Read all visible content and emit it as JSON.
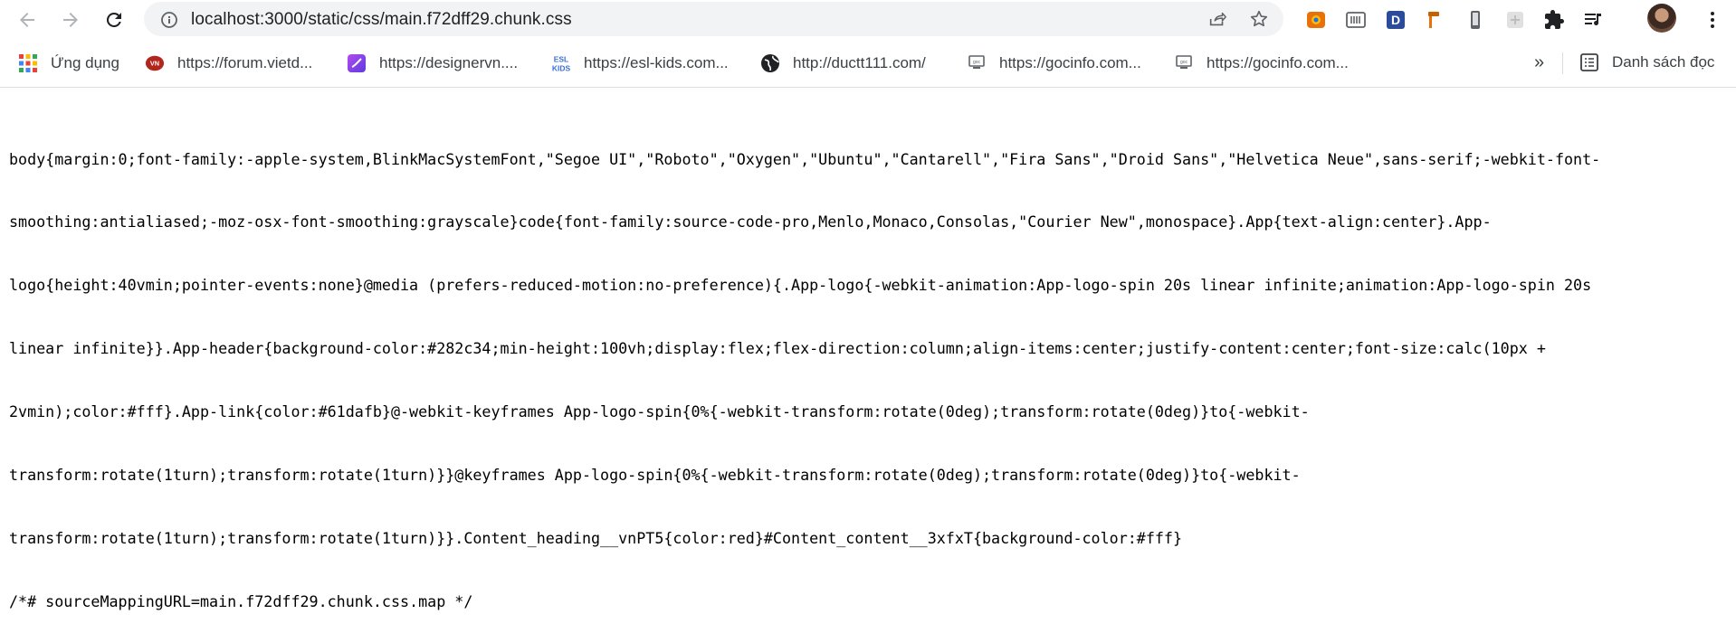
{
  "browser": {
    "url": "localhost:3000/static/css/main.f72dff29.chunk.css",
    "nav_icons": [
      "back-arrow-icon",
      "forward-arrow-icon",
      "reload-icon"
    ],
    "omnibox_icons": [
      "info-icon",
      "share-icon",
      "star-icon"
    ],
    "extensions": [
      "orange-camera-extension-icon",
      "barcode-extension-icon",
      "d-badge-extension-icon",
      "hammer-extension-icon",
      "phone-extension-icon",
      "gray-square-extension-icon",
      "puzzle-icon",
      "media-control-icon"
    ],
    "menu_icon": "three-dots-menu-icon"
  },
  "bookmarks": {
    "apps_label": "Ứng dụng",
    "items": [
      {
        "label": "https://forum.vietd...",
        "icon": "forum-favicon",
        "color": "#b3261e"
      },
      {
        "label": "https://designervn....",
        "icon": "designervn-favicon",
        "color": "#7b3fe4"
      },
      {
        "label": "https://esl-kids.com...",
        "icon": "esl-kids-favicon",
        "color": "#3b6fd6"
      },
      {
        "label": "http://ductt111.com/",
        "icon": "globe-icon",
        "color": "#202124"
      },
      {
        "label": "https://gocinfo.com...",
        "icon": "gocinfo-favicon",
        "color": "#5f6368"
      },
      {
        "label": "https://gocinfo.com...",
        "icon": "gocinfo-favicon",
        "color": "#5f6368"
      }
    ],
    "more_label": "»",
    "reading_list_label": "Danh sách đọc"
  },
  "content": {
    "lines": [
      "body{margin:0;font-family:-apple-system,BlinkMacSystemFont,\"Segoe UI\",\"Roboto\",\"Oxygen\",\"Ubuntu\",\"Cantarell\",\"Fira Sans\",\"Droid Sans\",\"Helvetica Neue\",sans-serif;-webkit-font-",
      "smoothing:antialiased;-moz-osx-font-smoothing:grayscale}code{font-family:source-code-pro,Menlo,Monaco,Consolas,\"Courier New\",monospace}.App{text-align:center}.App-",
      "logo{height:40vmin;pointer-events:none}@media (prefers-reduced-motion:no-preference){.App-logo{-webkit-animation:App-logo-spin 20s linear infinite;animation:App-logo-spin 20s",
      "linear infinite}}.App-header{background-color:#282c34;min-height:100vh;display:flex;flex-direction:column;align-items:center;justify-content:center;font-size:calc(10px +",
      "2vmin);color:#fff}.App-link{color:#61dafb}@-webkit-keyframes App-logo-spin{0%{-webkit-transform:rotate(0deg);transform:rotate(0deg)}to{-webkit-",
      "transform:rotate(1turn);transform:rotate(1turn)}}@keyframes App-logo-spin{0%{-webkit-transform:rotate(0deg);transform:rotate(0deg)}to{-webkit-",
      "transform:rotate(1turn);transform:rotate(1turn)}}.Content_heading__vnPT5{color:red}#Content_content__3xfxT{background-color:#fff}",
      "/*# sourceMappingURL=main.f72dff29.chunk.css.map */"
    ]
  }
}
